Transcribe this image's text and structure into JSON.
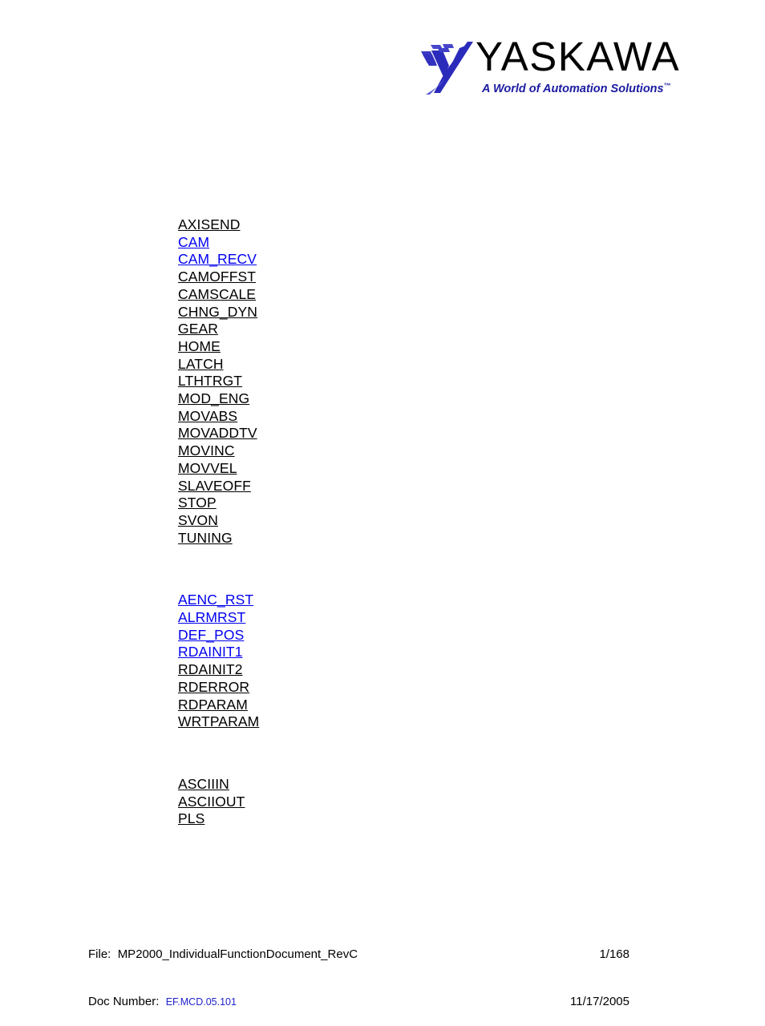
{
  "logo": {
    "mark_name": "yaskawa-swoosh-icon",
    "wordmark": "YASKAWA",
    "tagline": "A World of Automation Solutions",
    "trademark_symbol": "™",
    "mark_color": "#2b2bbb",
    "tagline_color": "#1b1ba0",
    "wordmark_color": "#000000"
  },
  "content": {
    "groups": [
      {
        "name": "motion-function-group",
        "items": [
          {
            "label": "AXISEND",
            "visited": false
          },
          {
            "label": "CAM",
            "visited": true
          },
          {
            "label": "CAM_RECV",
            "visited": true
          },
          {
            "label": "CAMOFFST",
            "visited": false
          },
          {
            "label": "CAMSCALE",
            "visited": false
          },
          {
            "label": "CHNG_DYN",
            "visited": false
          },
          {
            "label": "GEAR",
            "visited": false
          },
          {
            "label": "HOME",
            "visited": false
          },
          {
            "label": "LATCH",
            "visited": false
          },
          {
            "label": "LTHTRGT",
            "visited": false
          },
          {
            "label": "MOD_ENG",
            "visited": false
          },
          {
            "label": "MOVABS",
            "visited": false
          },
          {
            "label": "MOVADDTV",
            "visited": false
          },
          {
            "label": "MOVINC",
            "visited": false
          },
          {
            "label": "MOVVEL",
            "visited": false
          },
          {
            "label": "SLAVEOFF",
            "visited": false
          },
          {
            "label": "STOP",
            "visited": false
          },
          {
            "label": "SVON",
            "visited": false
          },
          {
            "label": "TUNING",
            "visited": false
          }
        ]
      },
      {
        "name": "servo-utility-function-group",
        "items": [
          {
            "label": "AENC_RST",
            "visited": true
          },
          {
            "label": "ALRMRST",
            "visited": true
          },
          {
            "label": "DEF_POS",
            "visited": true
          },
          {
            "label": "RDAINIT1",
            "visited": true
          },
          {
            "label": "RDAINIT2",
            "visited": false
          },
          {
            "label": "RDERROR",
            "visited": false
          },
          {
            "label": "RDPARAM",
            "visited": false
          },
          {
            "label": "WRTPARAM",
            "visited": false
          }
        ]
      },
      {
        "name": "io-function-group",
        "items": [
          {
            "label": "ASCIIIN",
            "visited": false
          },
          {
            "label": "ASCIIOUT",
            "visited": false
          },
          {
            "label": "PLS",
            "visited": false
          }
        ]
      }
    ]
  },
  "footer": {
    "file_label": "File:  ",
    "file_name": "MP2000_IndividualFunctionDocument_RevC",
    "doc_label": "Doc Number:  ",
    "doc_number": "EF.MCD.05.101",
    "page": "1/168",
    "date": "11/17/2005",
    "link_color": "#0000ee",
    "doc_number_color": "#2222cc"
  }
}
